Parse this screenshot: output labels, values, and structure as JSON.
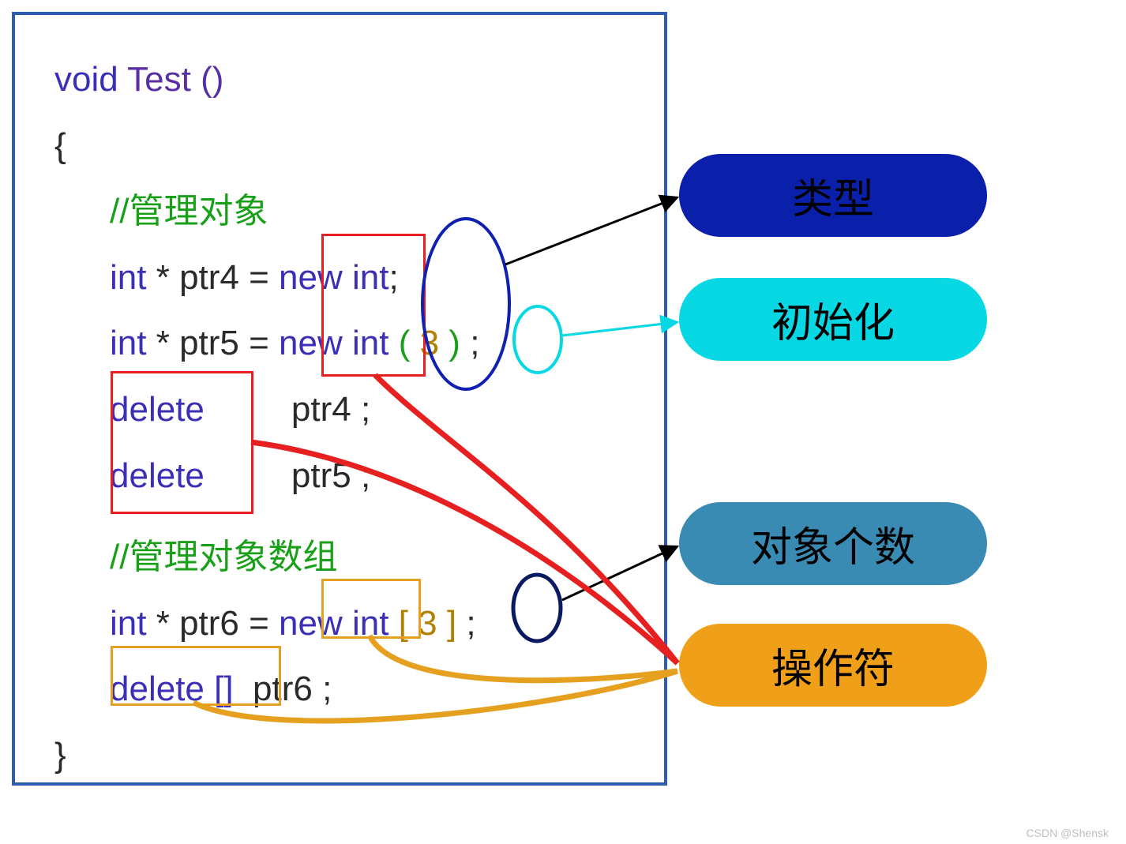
{
  "code": {
    "sig_void": "void",
    "sig_name": " Test ()",
    "open_brace": "{",
    "close_brace": "}",
    "comment1": "//管理对象",
    "decl4_int": "int",
    "decl4_star": " * ",
    "decl4_name": "ptr4",
    "decl4_eq": " = ",
    "decl4_new": "new",
    "decl4_type": "int",
    "decl4_semi": ";",
    "decl5_int": "int",
    "decl5_star": " * ",
    "decl5_name": "ptr5",
    "decl5_eq": " = ",
    "decl5_new": "new",
    "decl5_type": "int",
    "decl5_lp": " ( ",
    "decl5_num": "3",
    "decl5_rp": " ) ",
    "decl5_semi": ";",
    "del4_kw": "delete",
    "del4_sp": "         ",
    "del4_name": "ptr4",
    "del4_semi": " ;",
    "del5_kw": "delete",
    "del5_sp": "         ",
    "del5_name": "ptr5",
    "del5_semi": " ;",
    "comment2": "//管理对象数组",
    "decl6_int": "int",
    "decl6_star": " * ",
    "decl6_name": "ptr6",
    "decl6_eq": " = ",
    "decl6_new": "new",
    "decl6_type": " int ",
    "decl6_lb": "[ ",
    "decl6_num": "3",
    "decl6_rb": " ] ",
    "decl6_semi": ";",
    "del6_kw": "delete []",
    "del6_sp": "  ",
    "del6_name": "ptr6",
    "del6_semi": " ;"
  },
  "labels": {
    "type": "类型",
    "init": "初始化",
    "count": "对象个数",
    "operator": "操作符"
  },
  "watermark": "CSDN @Shensk",
  "colors": {
    "frame": "#2d5db0",
    "red": "#e62020",
    "orange": "#e6a020",
    "blue_ellipse": "#1020b0",
    "cyan_ellipse": "#08d8e4",
    "navy_ellipse": "#0a1a60"
  },
  "annotations": {
    "red_box_new": "around 'new' on lines ptr4/ptr5",
    "red_box_delete": "around 'delete' x2",
    "orange_box_new": "around 'new' on ptr6",
    "orange_box_delete": "around 'delete []'",
    "blue_ellipse_int": "around 'int' type on ptr4/ptr5",
    "cyan_ellipse_3": "around '3' init value on ptr5",
    "navy_ellipse_3": "around '3' array count on ptr6",
    "arrows": {
      "int_to_type": "black arrow",
      "3_to_init": "cyan arrow",
      "3arr_to_count": "black arrow",
      "new_red_to_operator": "red curved connector pair",
      "new_orange_to_operator": "orange curved connector pair"
    }
  }
}
